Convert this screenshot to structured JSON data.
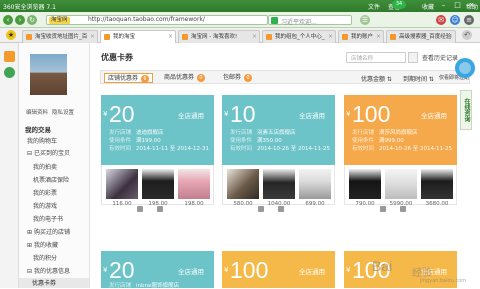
{
  "browser": {
    "title": "360安全浏览器 7.1",
    "menu": [
      "文件",
      "查看",
      "收藏"
    ],
    "badge": "34",
    "tools_label": "帮助",
    "address_prefix": "淘宝网",
    "url": "http://taoquan.taobao.com/framework/",
    "search_placeholder": "习近平欢迎...",
    "tabs": [
      {
        "label": "淘宝收货地址图片_百"
      },
      {
        "label": "我的淘宝"
      },
      {
        "label": "淘宝网 - 淘我喜欢!"
      },
      {
        "label": "我的组包_个人中心_"
      },
      {
        "label": "我的账户"
      },
      {
        "label": "高级搜索器_百度经验"
      }
    ]
  },
  "sidebar": {
    "avatar_alt": "用户头像",
    "links": [
      "编辑资料",
      "隐私设置"
    ],
    "section_title": "我的交易",
    "items": [
      {
        "label": "我的购物车"
      },
      {
        "label": "已买到的宝贝",
        "expandable": true
      },
      {
        "label": "我的拍卖"
      },
      {
        "label": "机票酒店保险"
      },
      {
        "label": "我的彩票"
      },
      {
        "label": "我的游戏"
      },
      {
        "label": "我的电子书"
      },
      {
        "label": "购买过的店铺",
        "expandable": true
      },
      {
        "label": "我的收藏",
        "expandable": true
      },
      {
        "label": "我的积分"
      },
      {
        "label": "我的优惠信息",
        "expandable": true
      },
      {
        "label": "优惠卡券",
        "active": true
      }
    ]
  },
  "main": {
    "title": "优惠卡券",
    "search_placeholder": "店铺名称",
    "history": "查看历史记录",
    "filters": [
      {
        "label": "店铺优惠券",
        "count": "6",
        "selected": true
      },
      {
        "label": "商品优惠券",
        "count": "0"
      },
      {
        "label": "包邮券",
        "count": "0"
      }
    ],
    "sort": [
      "优惠金额 ⇅",
      "到期时间 ⇅",
      "仅看即将过期"
    ],
    "side_tab": "在线咨询",
    "cards": [
      {
        "yen": "¥",
        "amount": "20",
        "scope": "全店通用",
        "shop_label": "发行店铺",
        "shop": "迪迪旗舰店",
        "cond_label": "使用条件",
        "cond": "满199.00",
        "date_label": "有效时间",
        "date": "2014-11-11 至 2014-12-31",
        "color": "#6cc3c8",
        "prices": [
          "116.00",
          "198.00",
          "198.00"
        ]
      },
      {
        "yen": "¥",
        "amount": "10",
        "scope": "全店通用",
        "shop_label": "发行店铺",
        "shop": "羽素五店旗舰店",
        "cond_label": "使用条件",
        "cond": "满350.00",
        "date_label": "有效时间",
        "date": "2014-10-26 至 2014-11-25",
        "color": "#6cc3c8",
        "prices": [
          "580.00",
          "1040.00",
          "699.00"
        ]
      },
      {
        "yen": "¥",
        "amount": "100",
        "scope": "全店通用",
        "shop_label": "发行店铺",
        "shop": "浪莎风尚旗舰店",
        "cond_label": "使用条件",
        "cond": "满999.00",
        "date_label": "有效时间",
        "date": "2014-10-26 至 2014-11-25",
        "color": "#f5a94a",
        "prices": [
          "790.00",
          "5990.00",
          "3680.00"
        ]
      },
      {
        "yen": "¥",
        "amount": "20",
        "scope": "全店通用",
        "shop_label": "发行店铺",
        "shop": "inbrai服饰旗舰店",
        "color": "#6cc3c8"
      },
      {
        "yen": "¥",
        "amount": "100",
        "scope": "全店通用",
        "color": "#f5b94a"
      },
      {
        "yen": "¥",
        "amount": "100",
        "scope": "全店通用",
        "color": "#f5b94a"
      }
    ]
  },
  "watermark": {
    "brand": "Bai",
    "cn": "经验",
    "url": "jingyan.baidu.com"
  }
}
